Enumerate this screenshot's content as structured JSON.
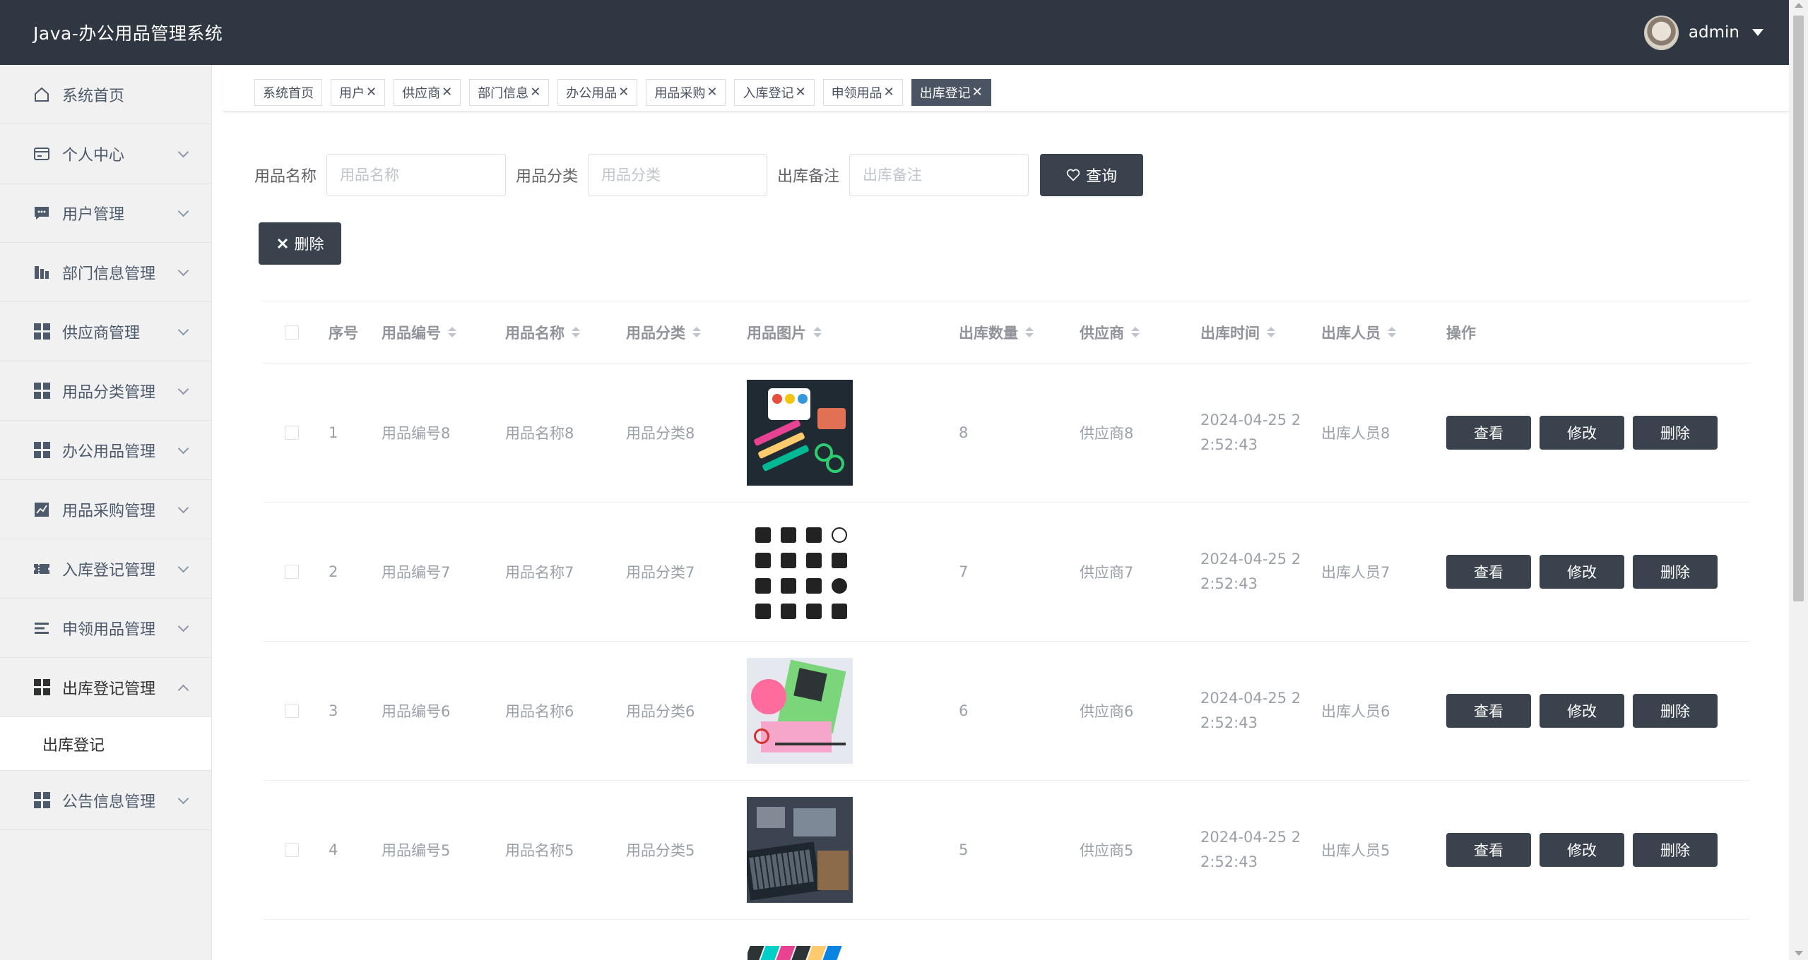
{
  "app": {
    "title": "Java-办公用品管理系统",
    "username": "admin"
  },
  "sidebar": {
    "items": [
      {
        "label": "系统首页",
        "icon": "home-icon"
      },
      {
        "label": "个人中心",
        "icon": "id-card-icon"
      },
      {
        "label": "用户管理",
        "icon": "chat-icon"
      },
      {
        "label": "部门信息管理",
        "icon": "building-icon"
      },
      {
        "label": "供应商管理",
        "icon": "grid-icon"
      },
      {
        "label": "用品分类管理",
        "icon": "grid-icon"
      },
      {
        "label": "办公用品管理",
        "icon": "grid-icon"
      },
      {
        "label": "用品采购管理",
        "icon": "chart-icon"
      },
      {
        "label": "入库登记管理",
        "icon": "ticket-icon"
      },
      {
        "label": "申领用品管理",
        "icon": "list-icon"
      },
      {
        "label": "出库登记管理",
        "icon": "grid-icon"
      },
      {
        "label": "公告信息管理",
        "icon": "grid-icon"
      }
    ],
    "active_sub": "出库登记"
  },
  "tabs": [
    {
      "label": "系统首页",
      "closable": false
    },
    {
      "label": "用户",
      "closable": true
    },
    {
      "label": "供应商",
      "closable": true
    },
    {
      "label": "部门信息",
      "closable": true
    },
    {
      "label": "办公用品",
      "closable": true
    },
    {
      "label": "用品采购",
      "closable": true
    },
    {
      "label": "入库登记",
      "closable": true
    },
    {
      "label": "申领用品",
      "closable": true
    },
    {
      "label": "出库登记",
      "closable": true,
      "active": true
    }
  ],
  "search": {
    "name_label": "用品名称",
    "name_placeholder": "用品名称",
    "category_label": "用品分类",
    "category_placeholder": "用品分类",
    "remark_label": "出库备注",
    "remark_placeholder": "出库备注",
    "query_label": "查询",
    "delete_label": "删除"
  },
  "table": {
    "headers": {
      "idx": "序号",
      "code": "用品编号",
      "name": "用品名称",
      "category": "用品分类",
      "image": "用品图片",
      "qty": "出库数量",
      "supplier": "供应商",
      "time": "出库时间",
      "person": "出库人员",
      "ops": "操作"
    },
    "rows": [
      {
        "idx": "1",
        "code": "用品编号8",
        "name": "用品名称8",
        "category": "用品分类8",
        "qty": "8",
        "supplier": "供应商8",
        "time": "2024-04-25 22:52:43",
        "person": "出库人员8"
      },
      {
        "idx": "2",
        "code": "用品编号7",
        "name": "用品名称7",
        "category": "用品分类7",
        "qty": "7",
        "supplier": "供应商7",
        "time": "2024-04-25 22:52:43",
        "person": "出库人员7"
      },
      {
        "idx": "3",
        "code": "用品编号6",
        "name": "用品名称6",
        "category": "用品分类6",
        "qty": "6",
        "supplier": "供应商6",
        "time": "2024-04-25 22:52:43",
        "person": "出库人员6"
      },
      {
        "idx": "4",
        "code": "用品编号5",
        "name": "用品名称5",
        "category": "用品分类5",
        "qty": "5",
        "supplier": "供应商5",
        "time": "2024-04-25 22:52:43",
        "person": "出库人员5"
      }
    ],
    "ops": {
      "view": "查看",
      "edit": "修改",
      "delete": "删除"
    }
  },
  "colors": {
    "header_bg": "#2f3742",
    "button_dark": "#3a424d",
    "sidebar_bg": "#f1f1f1"
  }
}
